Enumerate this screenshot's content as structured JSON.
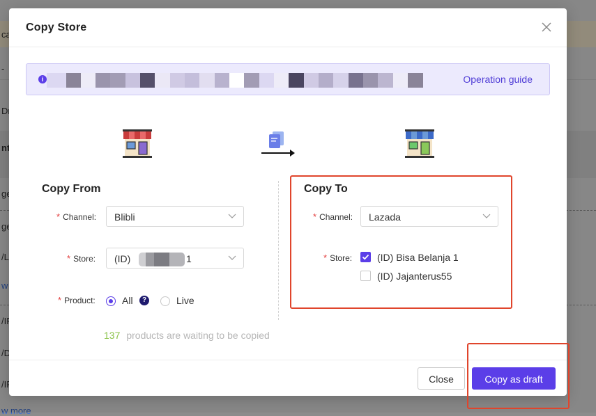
{
  "modal": {
    "title": "Copy Store",
    "notice_link": "Operation guide",
    "copy_from": {
      "title": "Copy From",
      "channel_label": "Channel:",
      "channel_value": "Blibli",
      "store_label": "Store:",
      "store_value_prefix": "(ID)",
      "store_value_suffix": "1",
      "product_label": "Product:",
      "product_options": [
        "All",
        "Live"
      ],
      "product_selected": "All"
    },
    "copy_to": {
      "title": "Copy To",
      "channel_label": "Channel:",
      "channel_value": "Lazada",
      "store_label": "Store:",
      "stores": [
        {
          "label": "(ID) Bisa Belanja 1",
          "checked": true
        },
        {
          "label": "(ID) Jajanterus55",
          "checked": false
        }
      ]
    },
    "count": {
      "number": "137",
      "text": "products are waiting to be copied"
    },
    "buttons": {
      "close": "Close",
      "copy_as_draft": "Copy as draft"
    }
  },
  "background": {
    "fragments": [
      "ca",
      "-",
      "Dr",
      "nt",
      "ge,",
      "ge,",
      "/L",
      "w",
      "/IR",
      "/DI",
      "/IR",
      "w more"
    ]
  },
  "colors": {
    "accent": "#5b3ee8",
    "required": "#e34040",
    "count_number": "#8bc34a",
    "annotation_red": "#e0452c"
  }
}
